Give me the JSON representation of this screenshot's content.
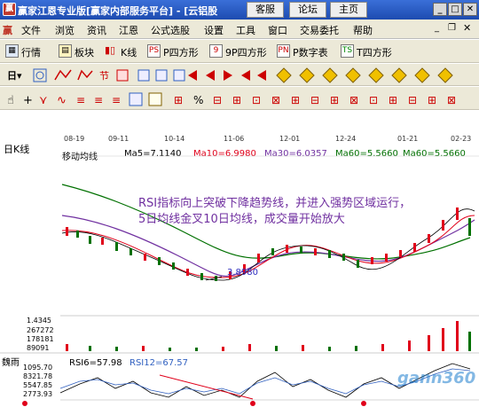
{
  "titlebar": {
    "title": "赢家江恩专业版[赢家内部服务平台] - [云铝股",
    "btn_service": "客服",
    "btn_forum": "论坛",
    "btn_home": "主页"
  },
  "menus": [
    "文件",
    "浏览",
    "资讯",
    "江恩",
    "公式选股",
    "设置",
    "工具",
    "窗口",
    "交易委托",
    "帮助"
  ],
  "toolbar1": {
    "quotes": "行情",
    "sector": "板块",
    "kline": "K线",
    "p_square": "P四方形",
    "nine_p_square": "9P四方形",
    "p_number": "P数字表",
    "t_square": "T四方形"
  },
  "chart": {
    "period": "日K线",
    "dates": [
      "08-19",
      "09-11",
      "10-14",
      "11-06",
      "12-01",
      "12-24",
      "01-21",
      "02-23"
    ],
    "ma_label": "移动均线",
    "ma5": "Ma5=7.1140",
    "ma10": "Ma10=6.9980",
    "ma30": "Ma30=6.0357",
    "ma60": "Ma60=5.5660",
    "ma60b": "Ma60=5.5660",
    "low_price": "3.8980",
    "annotation_line1": "RSI指标向上突破下降趋势线，并进入强势区域运行，",
    "annotation_line2": "5日均线金叉10日均线，成交量开始放大",
    "vol_labels": [
      "1.4345",
      "267272",
      "178181",
      "89091"
    ],
    "rsi_label": "魏雨",
    "rsi6": "RSI6=57.98",
    "rsi12": "RSI12=67.57",
    "rsi_labels": [
      "1095.70",
      "8321.78",
      "5547.85",
      "2773.93"
    ],
    "watermark": "gann360"
  },
  "colors": {
    "ma5": "#000000",
    "ma10": "#e0001a",
    "ma30": "#7030a0",
    "ma60": "#007000",
    "annotation": "#7030a0"
  }
}
